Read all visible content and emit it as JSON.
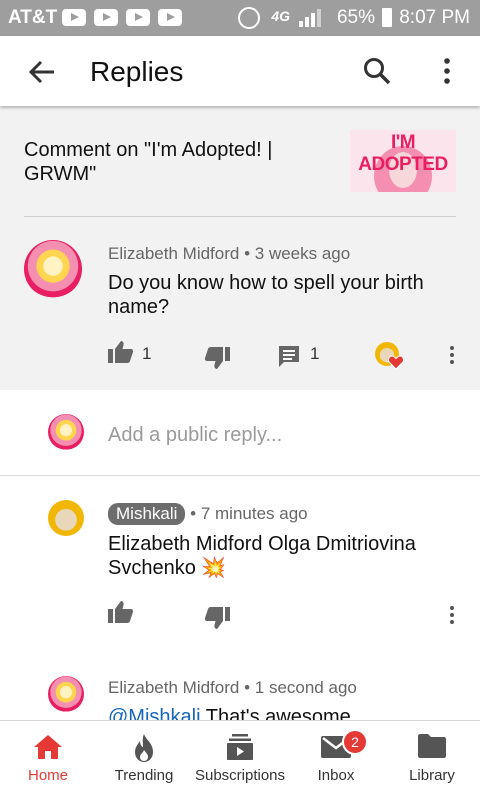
{
  "status_bar": {
    "carrier": "AT&T",
    "network": "4G",
    "battery_pct": "65%",
    "time": "8:07 PM"
  },
  "app_bar": {
    "title": "Replies"
  },
  "context": {
    "comment_on": "Comment on \"I'm Adopted! | GRWM\"",
    "thumbnail_text": "I'M ADOPTED"
  },
  "parent_comment": {
    "author": "Elizabeth Midford",
    "time": "3 weeks ago",
    "text": "Do you know how to spell your birth name?",
    "likes": "1",
    "replies": "1"
  },
  "reply_input": {
    "placeholder": "Add a public reply..."
  },
  "replies": [
    {
      "author": "Mishkali",
      "time": "7 minutes ago",
      "text": "Elizabeth Midford Olga Dmitriovina Svchenko",
      "emoji": "💥"
    },
    {
      "author": "Elizabeth Midford",
      "time": "1 second ago",
      "mention": "@Mishkali",
      "text": " That's awesome"
    }
  ],
  "bottom_nav": {
    "items": [
      {
        "label": "Home",
        "icon": "home-icon"
      },
      {
        "label": "Trending",
        "icon": "flame-icon"
      },
      {
        "label": "Subscriptions",
        "icon": "subscriptions-icon"
      },
      {
        "label": "Inbox",
        "icon": "mail-icon",
        "badge": "2"
      },
      {
        "label": "Library",
        "icon": "folder-icon"
      }
    ]
  },
  "colors": {
    "accent": "#e53935",
    "link": "#1565c0",
    "status_bar": "#9e9e9e",
    "highlight_bg": "#f2f2f2"
  }
}
